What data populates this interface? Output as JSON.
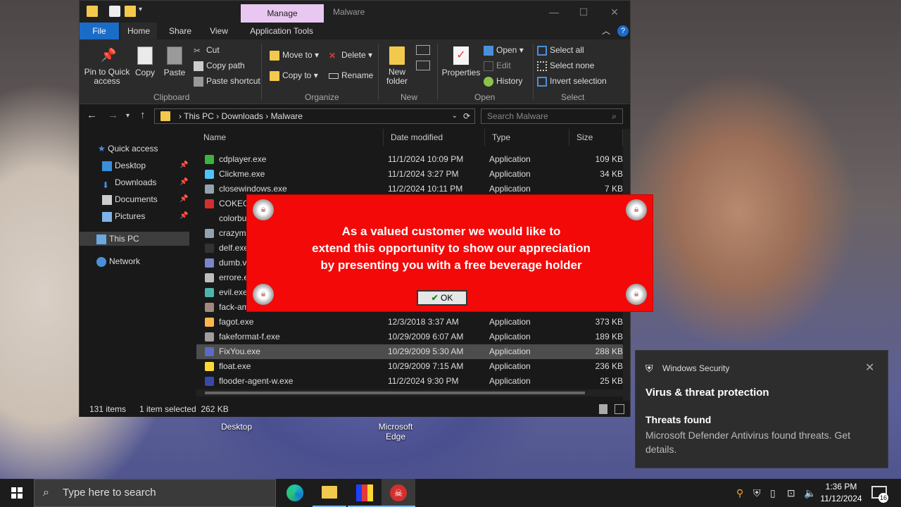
{
  "explorer": {
    "manage_tab": "Manage",
    "window_title": "Malware",
    "ribbon_tabs": [
      "File",
      "Home",
      "Share",
      "View",
      "Application Tools"
    ],
    "clipboard": {
      "pin": "Pin to Quick access",
      "copy": "Copy",
      "paste": "Paste",
      "cut": "Cut",
      "copy_path": "Copy path",
      "paste_shortcut": "Paste shortcut",
      "label": "Clipboard"
    },
    "organize": {
      "move_to": "Move to",
      "copy_to": "Copy to",
      "delete": "Delete",
      "rename": "Rename",
      "label": "Organize"
    },
    "new": {
      "new_folder": "New folder",
      "label": "New"
    },
    "open": {
      "properties": "Properties",
      "open": "Open",
      "edit": "Edit",
      "history": "History",
      "label": "Open"
    },
    "select": {
      "select_all": "Select all",
      "select_none": "Select none",
      "invert": "Invert selection",
      "label": "Select"
    },
    "breadcrumb": [
      "This PC",
      "Downloads",
      "Malware"
    ],
    "search_placeholder": "Search Malware",
    "nav": {
      "quick_access": "Quick access",
      "desktop": "Desktop",
      "downloads": "Downloads",
      "documents": "Documents",
      "pictures": "Pictures",
      "this_pc": "This PC",
      "network": "Network"
    },
    "columns": [
      "Name",
      "Date modified",
      "Type",
      "Size"
    ],
    "files": [
      {
        "name": "cdplayer.exe",
        "date": "11/1/2024 10:09 PM",
        "type": "Application",
        "size": "109 KB",
        "color": "#3db33d"
      },
      {
        "name": "Clickme.exe",
        "date": "11/1/2024 3:27 PM",
        "type": "Application",
        "size": "34 KB",
        "color": "#4fc3f7"
      },
      {
        "name": "closewindows.exe",
        "date": "11/2/2024 10:11 PM",
        "type": "Application",
        "size": "7 KB",
        "color": "#90a4ae"
      },
      {
        "name": "COKEG",
        "date": "",
        "type": "",
        "size": "",
        "color": "#d32f2f"
      },
      {
        "name": "colorbu",
        "date": "",
        "type": "",
        "size": "",
        "color": "#191919"
      },
      {
        "name": "crazyme",
        "date": "",
        "type": "",
        "size": "",
        "color": "#90a4ae"
      },
      {
        "name": "delf.exe",
        "date": "",
        "type": "",
        "size": "",
        "color": "#333333"
      },
      {
        "name": "dumb.v",
        "date": "",
        "type": "",
        "size": "",
        "color": "#7986cb"
      },
      {
        "name": "errore.e",
        "date": "",
        "type": "",
        "size": "",
        "color": "#bdbdbd"
      },
      {
        "name": "evil.exe",
        "date": "",
        "type": "",
        "size": "",
        "color": "#4db6ac"
      },
      {
        "name": "fack-am",
        "date": "",
        "type": "",
        "size": "",
        "color": "#a1887f"
      },
      {
        "name": "fagot.exe",
        "date": "12/3/2018 3:37 AM",
        "type": "Application",
        "size": "373 KB",
        "color": "#ffb74d"
      },
      {
        "name": "fakeformat-f.exe",
        "date": "10/29/2009 6:07 AM",
        "type": "Application",
        "size": "189 KB",
        "color": "#9e9e9e"
      },
      {
        "name": "FixYou.exe",
        "date": "10/29/2009 5:30 AM",
        "type": "Application",
        "size": "288 KB",
        "color": "#5c6bc0"
      },
      {
        "name": "float.exe",
        "date": "10/29/2009 7:15 AM",
        "type": "Application",
        "size": "236 KB",
        "color": "#fdd835"
      },
      {
        "name": "flooder-agent-w.exe",
        "date": "11/2/2024 9:30 PM",
        "type": "Application",
        "size": "25 KB",
        "color": "#3949ab"
      }
    ],
    "status": {
      "count": "131 items",
      "selected": "1 item selected  262 KB"
    }
  },
  "popup": {
    "line1": "As a valued customer we would like to",
    "line2": "extend this opportunity to show our appreciation",
    "line3": "by presenting you with a free beverage holder",
    "ok": "OK"
  },
  "desktop": {
    "desktop_label": "Desktop",
    "edge_label": "Microsoft Edge"
  },
  "toast": {
    "app": "Windows Security",
    "title": "Virus & threat protection",
    "subtitle": "Threats found",
    "body": "Microsoft Defender Antivirus found threats. Get details."
  },
  "taskbar": {
    "search_placeholder": "Type here to search",
    "time": "1:36 PM",
    "date": "11/12/2024",
    "notif_count": "16"
  }
}
